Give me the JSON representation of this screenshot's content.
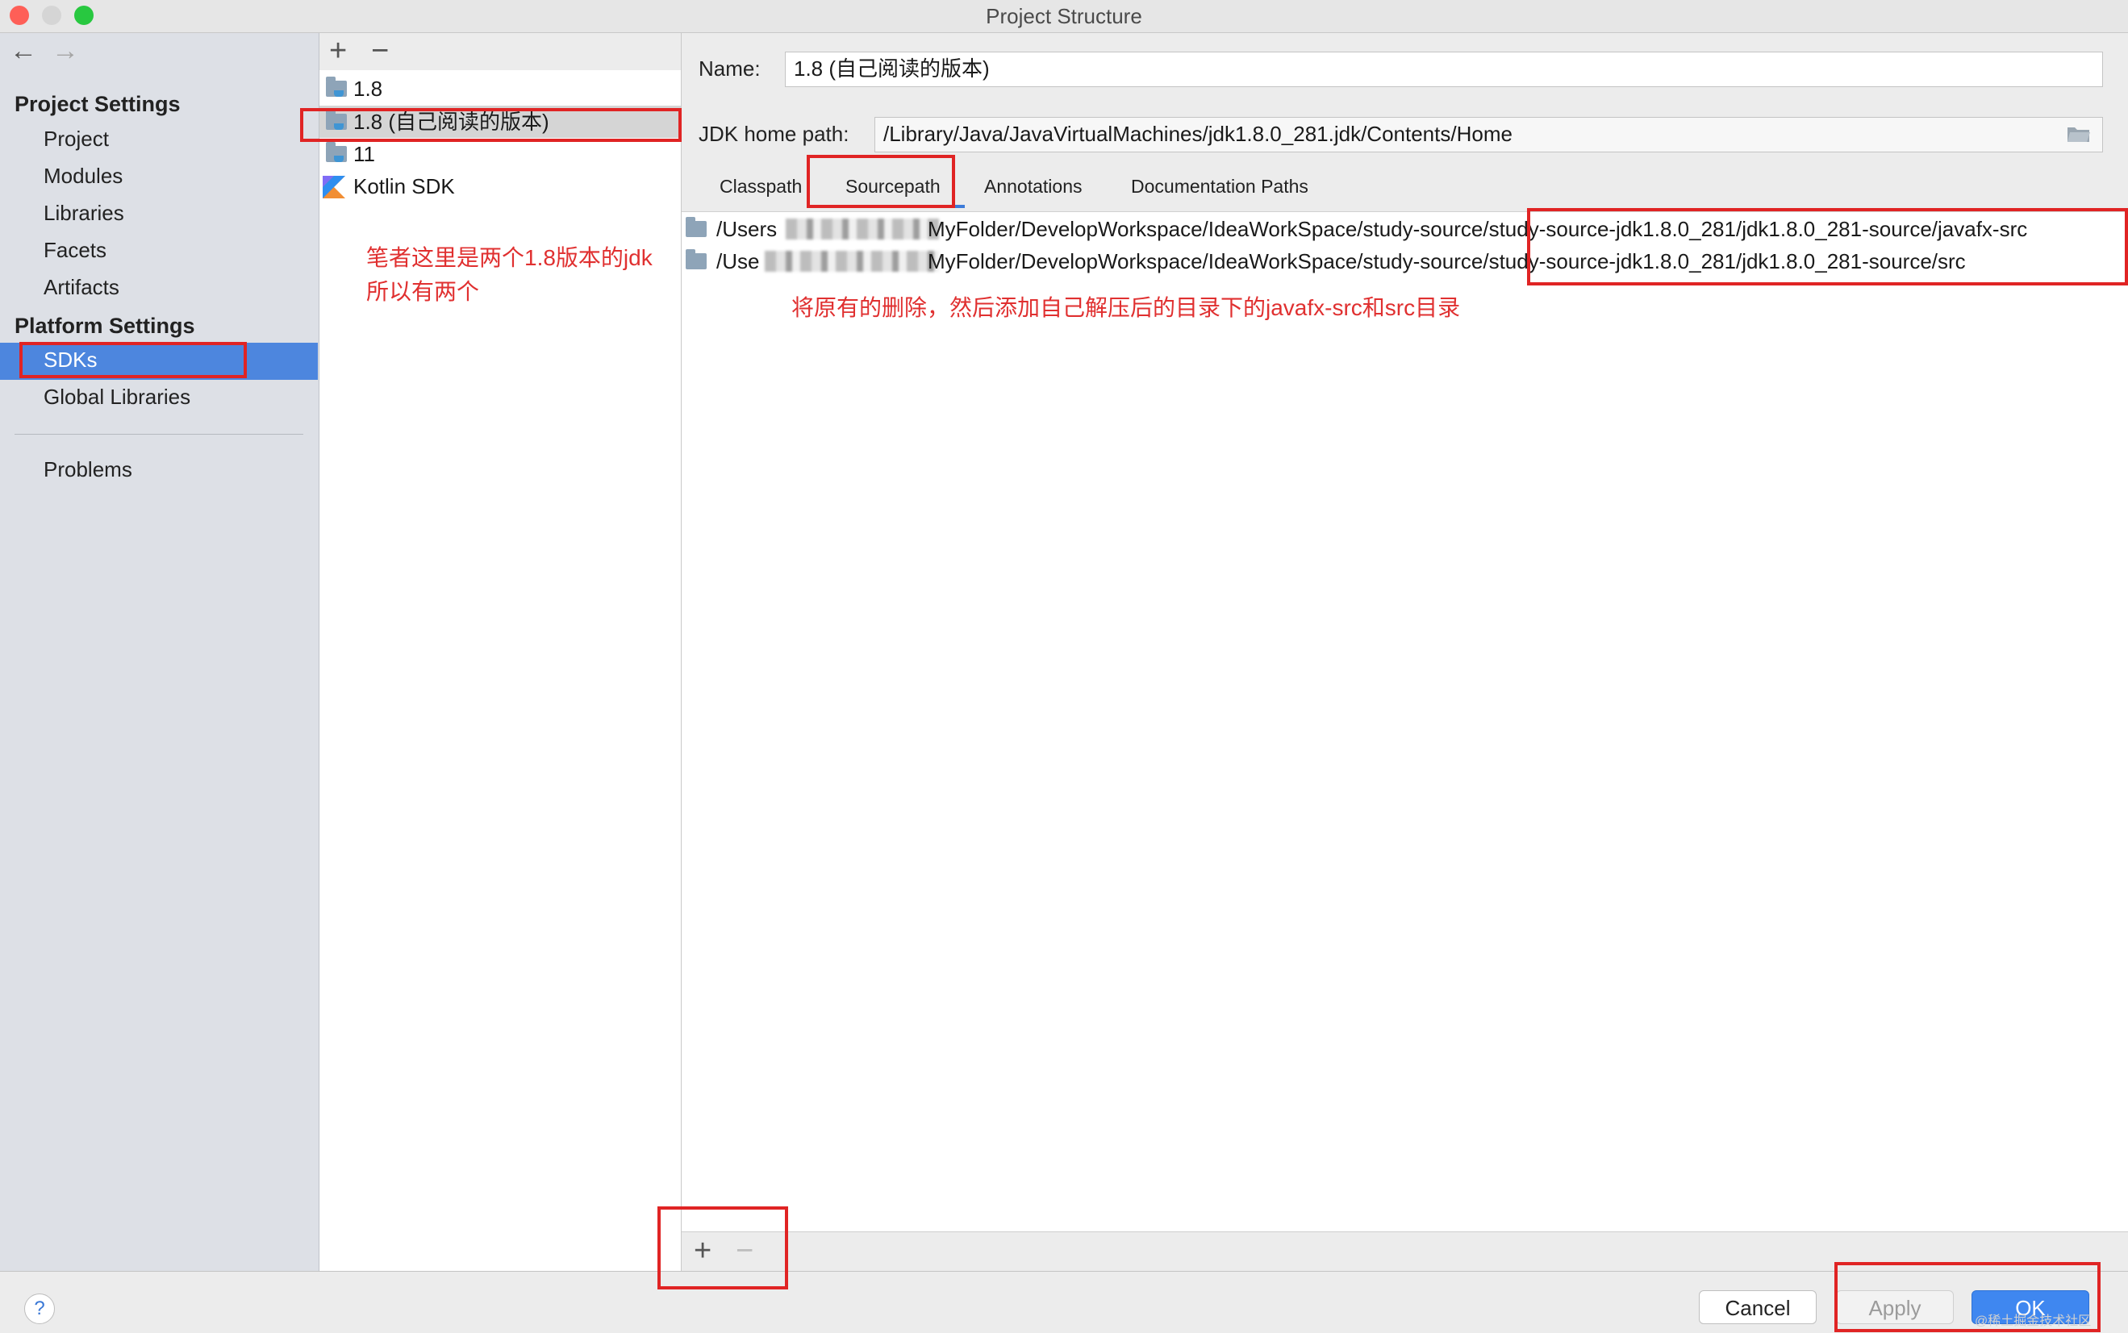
{
  "window": {
    "title": "Project Structure",
    "traffic_colors": [
      "#fe5f57",
      "#d5d5d5",
      "#28c840"
    ]
  },
  "nav": {
    "back_icon": "←",
    "forward_icon": "→",
    "project_settings_header": "Project Settings",
    "project_items": [
      "Project",
      "Modules",
      "Libraries",
      "Facets",
      "Artifacts"
    ],
    "platform_settings_header": "Platform Settings",
    "platform_items": [
      "SDKs",
      "Global Libraries"
    ],
    "problems": "Problems"
  },
  "sdk_list": {
    "add_icon": "+",
    "remove_icon": "−",
    "items": [
      "1.8",
      "1.8 (自己阅读的版本)",
      "11",
      "Kotlin SDK"
    ],
    "selected_index": 1
  },
  "details": {
    "name_label": "Name:",
    "name_value": "1.8 (自己阅读的版本)",
    "home_label": "JDK home path:",
    "home_value": "/Library/Java/JavaVirtualMachines/jdk1.8.0_281.jdk/Contents/Home",
    "tabs": [
      "Classpath",
      "Sourcepath",
      "Annotations",
      "Documentation Paths"
    ],
    "active_tab": "Sourcepath",
    "paths": [
      {
        "prefix": "/Users",
        "suffix": "MyFolder/DevelopWorkspace/IdeaWorkSpace/study-source/study-source-jdk1.8.0_281/jdk1.8.0_281-source/javafx-src"
      },
      {
        "prefix": "/Use",
        "suffix": "MyFolder/DevelopWorkspace/IdeaWorkSpace/study-source/study-source-jdk1.8.0_281/jdk1.8.0_281-source/src"
      }
    ],
    "add_icon": "+",
    "remove_icon": "−"
  },
  "buttons": {
    "help": "?",
    "cancel": "Cancel",
    "apply": "Apply",
    "ok": "OK"
  },
  "annotations": {
    "note_line1": "笔者这里是两个1.8版本的jdk",
    "note_line2": "所以有两个",
    "instruction": "将原有的删除，然后添加自己解压后的目录下的javafx-src和src目录",
    "watermark": "@稀土掘金技术社区",
    "color": "#e02424"
  }
}
